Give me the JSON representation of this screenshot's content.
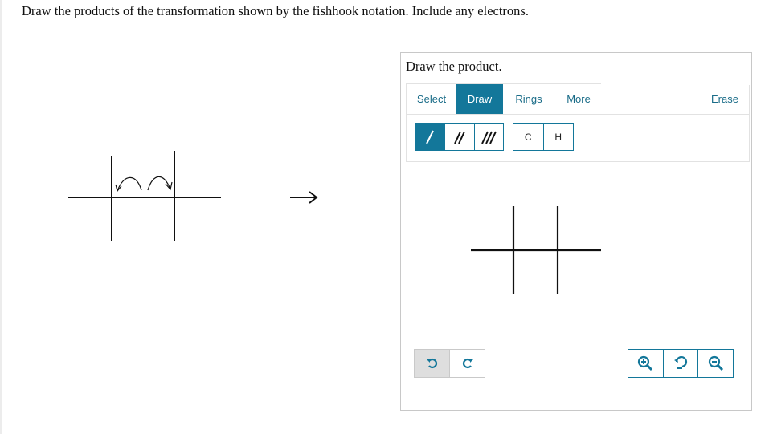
{
  "question": {
    "prompt": "Draw the products of the transformation shown by the fishhook notation. Include any electrons."
  },
  "panel": {
    "title": "Draw the product."
  },
  "toolbar": {
    "tabs": [
      {
        "label": "Select",
        "active": false
      },
      {
        "label": "Draw",
        "active": true
      },
      {
        "label": "Rings",
        "active": false
      },
      {
        "label": "More",
        "active": false
      }
    ],
    "erase_label": "Erase",
    "bond_tools": [
      {
        "name": "single-bond-icon",
        "active": true
      },
      {
        "name": "double-bond-icon",
        "active": false
      },
      {
        "name": "triple-bond-icon",
        "active": false
      }
    ],
    "atoms": [
      "C",
      "H"
    ]
  },
  "controls": {
    "undo_icon": "undo-icon",
    "redo_icon": "redo-icon",
    "zoom_in_icon": "zoom-in-icon",
    "reset_zoom_icon": "reset-zoom-icon",
    "zoom_out_icon": "zoom-out-icon"
  },
  "colors": {
    "accent": "#13779a",
    "tab_text": "#1a6c88",
    "panel_border": "#c8c8c8"
  }
}
